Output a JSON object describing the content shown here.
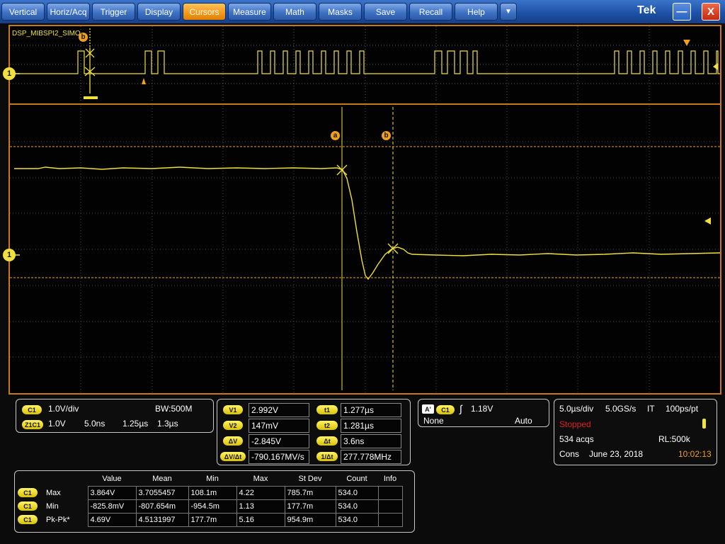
{
  "menu": {
    "items": [
      "Vertical",
      "Horiz/Acq",
      "Trigger",
      "Display",
      "Cursors",
      "Measure",
      "Math",
      "Masks",
      "Save",
      "Recall",
      "Help"
    ],
    "active": "Cursors",
    "dropdown_glyph": "▼",
    "brand": "Tek",
    "minimize_glyph": "—",
    "close_glyph": "X"
  },
  "display": {
    "bus_label": "DSP_MIBSPI2_SIMO",
    "channel_marker": "1",
    "cursor_a": "a",
    "cursor_b": "b",
    "colors": {
      "trace": "#f0e040",
      "cursor": "#f0a020",
      "frame": "#c8791a"
    }
  },
  "channel_panel": {
    "ch1_badge": "C1",
    "ch1_scale": "1.0V/div",
    "bw_label": "BW:500M",
    "z_badge": "Z1C1",
    "z_scale": "1.0V",
    "z_time": "5.0ns",
    "z_pos": "1.25µs",
    "z_pos2": "1.3µs"
  },
  "cursor_panel": {
    "rows": [
      {
        "badge": "V1",
        "value": "2.992V",
        "badge2": "t1",
        "value2": "1.277µs"
      },
      {
        "badge": "V2",
        "value": "147mV",
        "badge2": "t2",
        "value2": "1.281µs"
      },
      {
        "badge": "ΔV",
        "value": "-2.845V",
        "badge2": "Δt",
        "value2": "3.6ns"
      },
      {
        "badge": "ΔV/Δt",
        "value": "-790.167MV/s",
        "badge2": "1/Δt",
        "value2": "277.778MHz"
      }
    ]
  },
  "trigger_panel": {
    "a_badge": "A'",
    "ch_badge": "C1",
    "level": "1.18V",
    "coupling": "None",
    "mode": "Auto"
  },
  "acq_panel": {
    "timebase": "5.0µs/div",
    "sample_rate": "5.0GS/s",
    "it": "IT",
    "resolution": "100ps/pt",
    "status": "Stopped",
    "acqs": "534 acqs",
    "record_length": "RL:500k",
    "cons": "Cons",
    "date": "June 23, 2018",
    "time": "10:02:13"
  },
  "measurements": {
    "headers": [
      "Value",
      "Mean",
      "Min",
      "Max",
      "St Dev",
      "Count",
      "Info"
    ],
    "rows": [
      {
        "badge": "C1",
        "name": "Max",
        "cells": [
          "3.864V",
          "3.7055457",
          "108.1m",
          "4.22",
          "785.7m",
          "534.0",
          ""
        ]
      },
      {
        "badge": "C1",
        "name": "Min",
        "cells": [
          "-825.8mV",
          "-807.654m",
          "-954.5m",
          "1.13",
          "177.7m",
          "534.0",
          ""
        ]
      },
      {
        "badge": "C1",
        "name": "Pk-Pk*",
        "cells": [
          "4.69V",
          "4.5131997",
          "177.7m",
          "5.16",
          "954.9m",
          "534.0",
          ""
        ]
      }
    ]
  }
}
